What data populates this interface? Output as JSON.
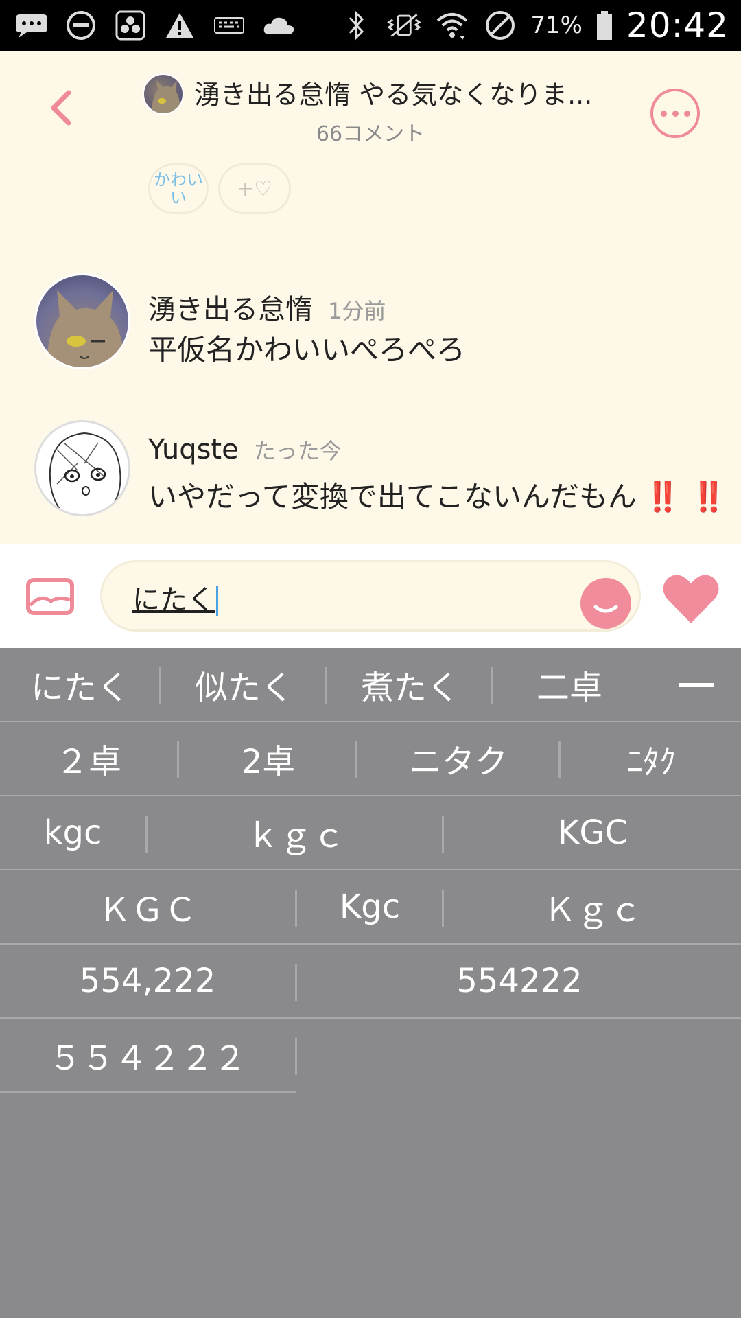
{
  "status_bar": {
    "battery": "71%",
    "time": "20:42"
  },
  "header": {
    "title": "湧き出る怠惰 やる気なくなりま...",
    "subtitle": "66コメント"
  },
  "reactions": {
    "kawaii": "かわいい",
    "add": "+♡"
  },
  "comments": [
    {
      "name": "湧き出る怠惰",
      "time": "1分前",
      "text": "平仮名かわいいぺろぺろ",
      "emoji": ""
    },
    {
      "name": "Yuqste",
      "time": "たった今",
      "text": "いやだって変換で出てこないんだもん",
      "emoji": "‼️ ‼️"
    }
  ],
  "input": {
    "value": "にたく"
  },
  "keyboard": {
    "rows": [
      [
        "にたく",
        "似たく",
        "煮たく",
        "二卓"
      ],
      [
        "２卓",
        "2卓",
        "ニタク",
        "ﾆﾀｸ"
      ],
      [
        "kgc",
        "ｋｇｃ",
        "KGC"
      ],
      [
        "ＫＧＣ",
        "Kgc",
        "Ｋｇｃ"
      ],
      [
        "554,222",
        "554222"
      ],
      [
        "５５４２２２"
      ]
    ]
  },
  "colors": {
    "accent": "#ef8a99",
    "background": "#fdf8e8",
    "keyboard": "#8a8a8c"
  }
}
